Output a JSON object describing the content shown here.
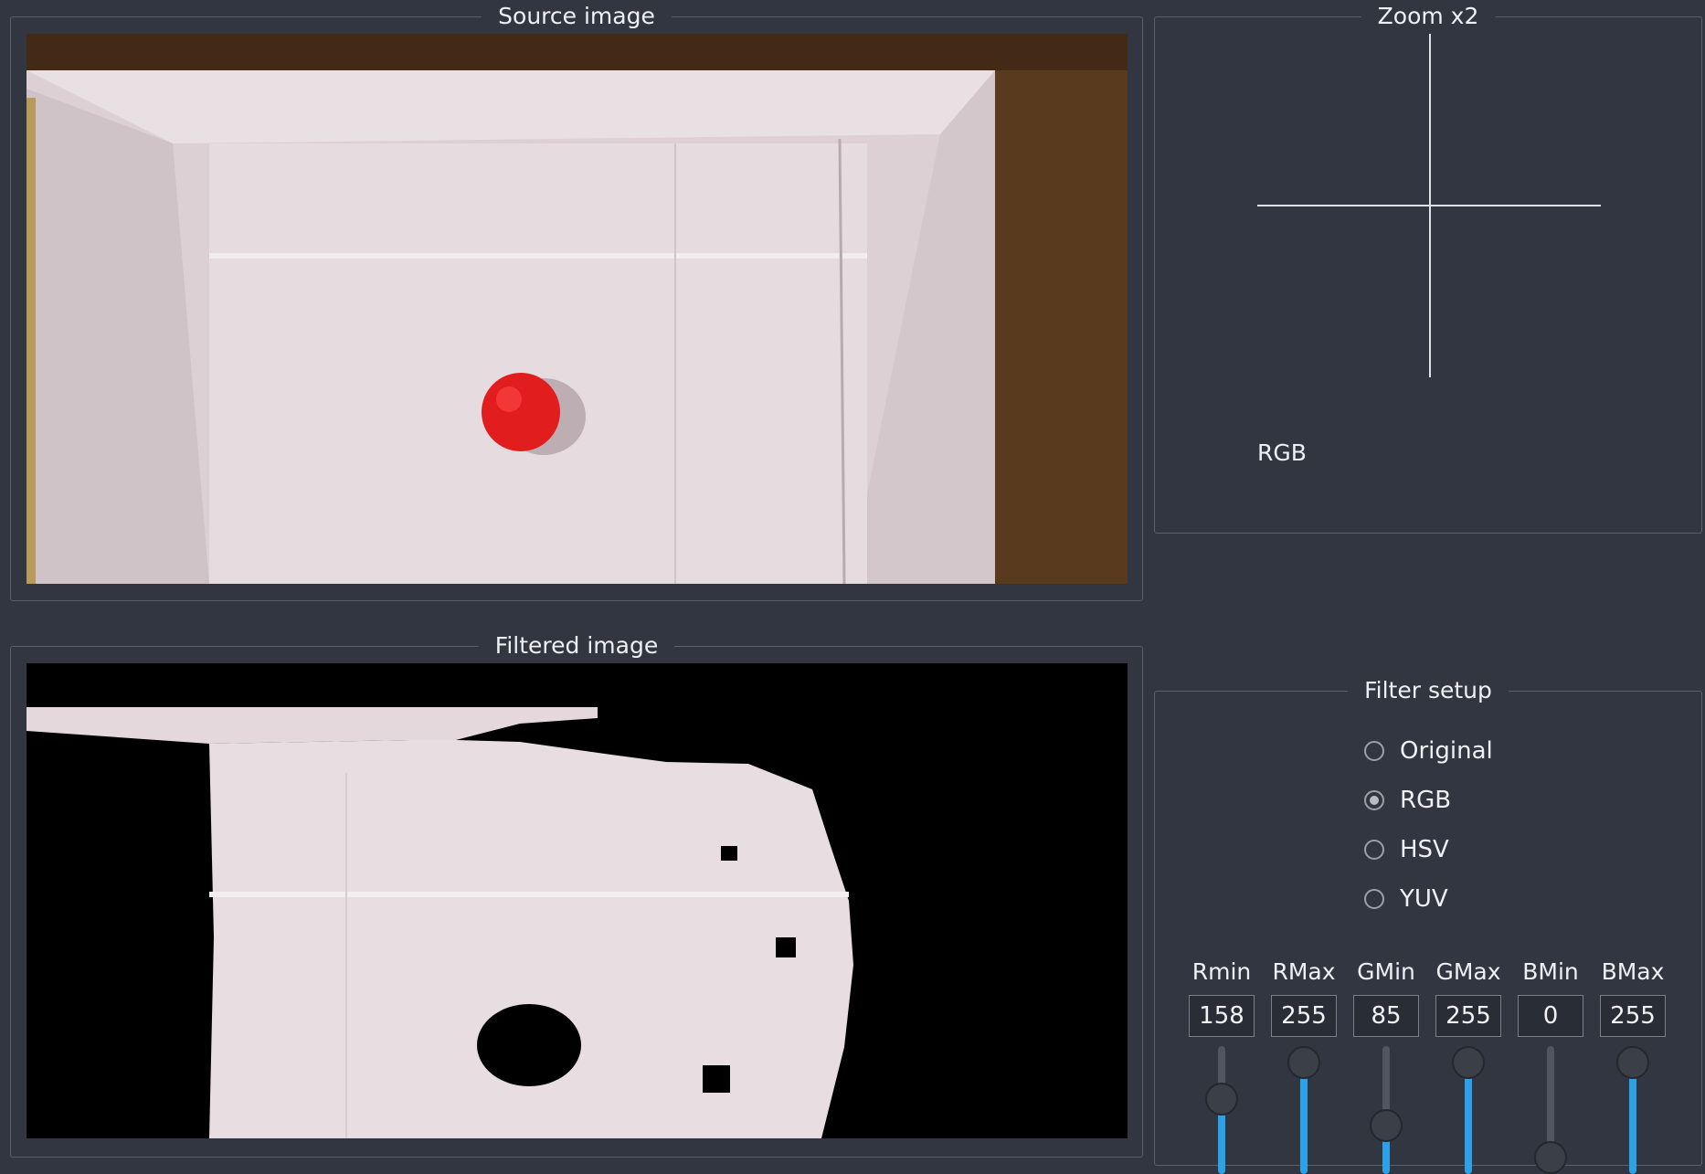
{
  "source_panel": {
    "title": "Source image"
  },
  "filtered_panel": {
    "title": "Filtered image"
  },
  "zoom_panel": {
    "title": "Zoom x2",
    "mode_label": "RGB"
  },
  "filter_panel": {
    "title": "Filter setup",
    "modes": [
      {
        "label": "Original",
        "selected": false
      },
      {
        "label": "RGB",
        "selected": true
      },
      {
        "label": "HSV",
        "selected": false
      },
      {
        "label": "YUV",
        "selected": false
      }
    ],
    "sliders": [
      {
        "label": "Rmin",
        "value": "158",
        "level": 158
      },
      {
        "label": "RMax",
        "value": "255",
        "level": 255
      },
      {
        "label": "GMin",
        "value": "85",
        "level": 85
      },
      {
        "label": "GMax",
        "value": "255",
        "level": 255
      },
      {
        "label": "BMin",
        "value": "0",
        "level": 0
      },
      {
        "label": "BMax",
        "value": "255",
        "level": 255
      }
    ],
    "slider_range": [
      0,
      255
    ],
    "accent_color": "#2aa1e8"
  }
}
